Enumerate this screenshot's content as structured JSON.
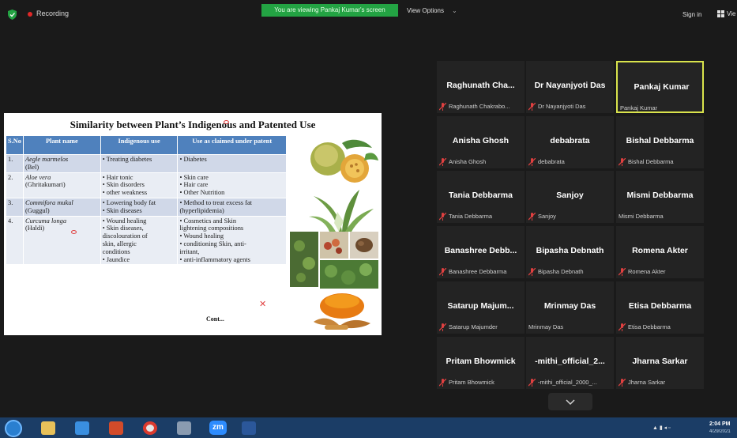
{
  "top_bar": {
    "recording_label": "Recording",
    "viewing_banner": "You are viewing Pankaj Kumar's screen",
    "view_options_label": "View Options",
    "sign_in_label": "Sign in",
    "view_label": "Vie",
    "recording_color": "#e02828",
    "banner_color": "#23a343"
  },
  "slide": {
    "title": "Similarity between Plant’s Indigenous and Patented Use",
    "headers": [
      "S.No",
      "Plant name",
      "Indigenous use",
      "Use as claimed under patent"
    ],
    "rows": [
      {
        "no": "1.",
        "plant_sci": "Aegle marmelos",
        "plant_common": "(Bel)",
        "indigenous": [
          "• Treating diabetes"
        ],
        "patent": [
          "• Diabetes"
        ]
      },
      {
        "no": "2.",
        "plant_sci": "Aloe vera",
        "plant_common": "(Ghritakumari)",
        "indigenous": [
          "• Hair tonic",
          "• Skin disorders",
          "• other weakness"
        ],
        "patent": [
          "• Skin care",
          "• Hair care",
          "• Other Nutrition"
        ]
      },
      {
        "no": "3.",
        "plant_sci": "Commifora mukul",
        "plant_common": "(Guggul)",
        "indigenous": [
          "• Lowering body fat",
          "• Skin diseases"
        ],
        "patent": [
          "• Method to treat excess fat",
          "(hyperlipidemia)"
        ]
      },
      {
        "no": "4.",
        "plant_sci": "Curcuma longa",
        "plant_common": "(Haldi)",
        "indigenous": [
          "• Wound healing",
          "• Skin diseases,",
          "discolouration of",
          "skin, allergic",
          "conditions",
          "• Jaundice"
        ],
        "patent": [
          "• Cosmetics and Skin",
          "lightening compositions",
          "• Wound healing",
          "• conditioning Skin, anti-",
          "irritant,",
          "• anti-inflammatory agents"
        ]
      }
    ],
    "cont_label": "Cont...",
    "header_color": "#4f81bd"
  },
  "participants": [
    {
      "name": "Raghunath  Cha...",
      "label": "Raghunath Chakrabo...",
      "muted": true,
      "active": false
    },
    {
      "name": "Dr Nayanjyoti Das",
      "label": "Dr Nayanjyoti Das",
      "muted": true,
      "active": false
    },
    {
      "name": "Pankaj Kumar",
      "label": "Pankaj Kumar",
      "muted": false,
      "active": true
    },
    {
      "name": "Anisha Ghosh",
      "label": "Anisha Ghosh",
      "muted": true,
      "active": false
    },
    {
      "name": "debabrata",
      "label": "debabrata",
      "muted": true,
      "active": false
    },
    {
      "name": "Bishal Debbarma",
      "label": "Bishal Debbarma",
      "muted": true,
      "active": false
    },
    {
      "name": "Tania Debbarma",
      "label": "Tania Debbarma",
      "muted": true,
      "active": false
    },
    {
      "name": "Sanjoy",
      "label": "Sanjoy",
      "muted": true,
      "active": false
    },
    {
      "name": "Mismi Debbarma",
      "label": "Mismi Debbarma",
      "muted": false,
      "active": false
    },
    {
      "name": "Banashree  Debb...",
      "label": "Banashree Debbarma",
      "muted": true,
      "active": false
    },
    {
      "name": "Bipasha Debnath",
      "label": "Bipasha Debnath",
      "muted": true,
      "active": false
    },
    {
      "name": "Romena Akter",
      "label": "Romena Akter",
      "muted": true,
      "active": false
    },
    {
      "name": "Satarup  Majum...",
      "label": "Satarup Majumder",
      "muted": true,
      "active": false
    },
    {
      "name": "Mrinmay Das",
      "label": "Mrinmay Das",
      "muted": false,
      "active": false
    },
    {
      "name": "Etisa Debbarma",
      "label": "Etisa Debbarma",
      "muted": true,
      "active": false
    },
    {
      "name": "Pritam Bhowmick",
      "label": "Pritam Bhowmick",
      "muted": true,
      "active": false
    },
    {
      "name": "-mithi_official_2...",
      "label": "-mithi_official_2000_...",
      "muted": true,
      "active": false
    },
    {
      "name": "Jharna Sarkar",
      "label": "Jharna Sarkar",
      "muted": true,
      "active": false
    }
  ],
  "taskbar": {
    "zoom_label": "zm",
    "clock_time": "2:04 PM",
    "clock_date": "4/29/2021"
  }
}
